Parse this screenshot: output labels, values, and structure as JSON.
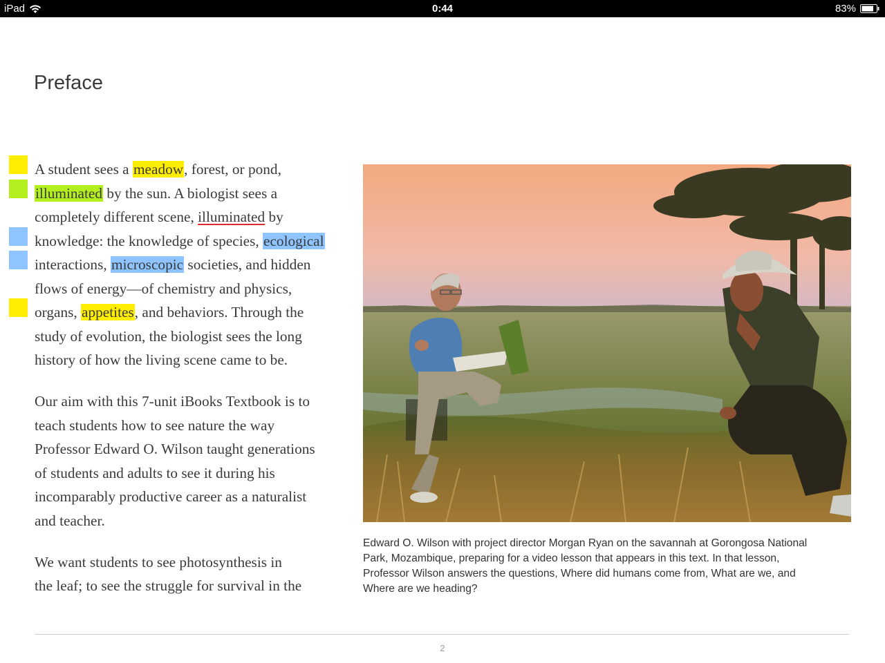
{
  "status_bar": {
    "device": "iPad",
    "time": "0:44",
    "battery_percent": "83%",
    "wifi_icon": "wifi-icon",
    "battery_icon": "battery-icon"
  },
  "page": {
    "title": "Preface",
    "paragraph1": {
      "l1_a": "A student sees a ",
      "l1_hl": "meadow",
      "l1_b": ", forest, or pond,",
      "l2_hl": "illuminated",
      "l2_b": " by the sun. A biologist sees a",
      "l3_a": "completely different scene, ",
      "l3_ul": "illuminated",
      "l3_b": " by",
      "l4_a": "knowledge: the knowledge of species, ",
      "l4_hl": "ecological",
      "l5_a": "interactions, ",
      "l5_hl": "microscopic",
      "l5_b": " societies, and hidden",
      "l6": "flows of energy—of chemistry and physics,",
      "l7_a": "organs, ",
      "l7_hl": "appetites",
      "l7_b": ", and behaviors. Through the",
      "l8": "study of evolution, the biologist sees the long",
      "l9": "history of how the living scene came to be."
    },
    "paragraph2": {
      "l1": "Our aim with this 7-unit iBooks Textbook is to",
      "l2": "teach students how to see nature the way",
      "l3": "Professor Edward O. Wilson taught generations",
      "l4": "of students and adults to see it during his",
      "l5": "incomparably productive career as a naturalist",
      "l6": "and teacher."
    },
    "paragraph3": {
      "l1": "We want students to see photosynthesis in",
      "l2": "the leaf; to see the struggle for survival in the"
    },
    "caption": {
      "l1": "Edward O. Wilson with project director Morgan Ryan on the savannah at Gorongosa National",
      "l2": "Park, Mozambique, preparing for a video lesson that appears in this text. In that lesson,",
      "l3": "Professor Wilson answers the questions, Where did humans come from, What are we, and",
      "l4": "Where are we heading?"
    },
    "page_number": "2"
  },
  "highlight_colors": {
    "yellow": "#ffee00",
    "green": "#b3ef1f",
    "blue": "#8ec4ff",
    "underline_red": "#e0282e"
  }
}
